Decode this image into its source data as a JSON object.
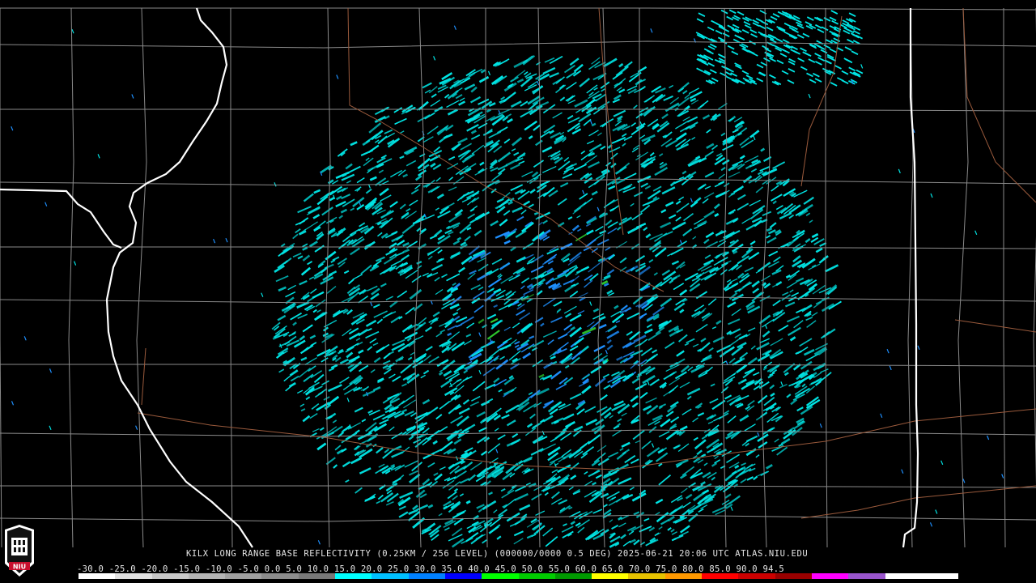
{
  "caption": "KILX LONG RANGE BASE REFLECTIVITY (0.25KM / 256 LEVEL) (000000/0000 0.5 DEG) 2025-06-21 20:06 UTC  ATLAS.NIU.EDU",
  "scale_labels": "-30.0 -25.0 -20.0 -15.0 -10.0 -5.0  0.0  5.0  10.0 15.0 20.0 25.0  30.0  35.0  40.0  45.0  50.0  55.0  60.0  65.0  70.0  75.0  80.0  85.0  90.0  94.5",
  "logo_text": "NIU",
  "colors": {
    "background": "#000000",
    "state_border": "#ffffff",
    "county_border": "#8a8a8a",
    "highway": "#9a5a3c",
    "echo_main": "#00e5e5",
    "echo_blue": "#1e90ff",
    "echo_green": "#2ecc2e",
    "logo_red": "#c8102e"
  },
  "colorbar": [
    "#ffffff",
    "#e0e0e0",
    "#c8c8c8",
    "#b4b4b4",
    "#a0a0a0",
    "#8c8c8c",
    "#787878",
    "#00ffff",
    "#00c0ff",
    "#0080ff",
    "#0000ff",
    "#00ff00",
    "#00cc00",
    "#009900",
    "#ffff00",
    "#e6c200",
    "#ff9900",
    "#ff0000",
    "#cc0000",
    "#990000",
    "#ff00ff",
    "#9955cc",
    "#ffffff",
    "#ffffff"
  ]
}
